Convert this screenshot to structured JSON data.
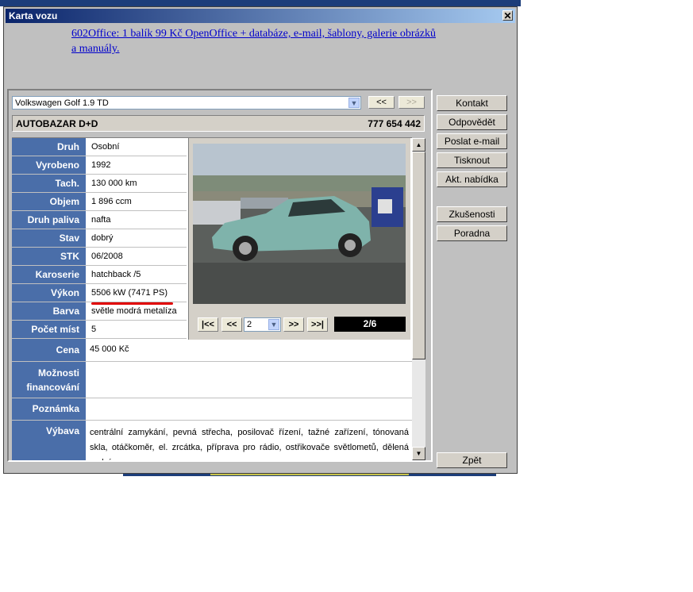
{
  "window": {
    "title": "Karta vozu"
  },
  "ad": {
    "text": "602Office: 1 balík 99 Kč OpenOffice + databáze, e-mail, šablony, galerie obrázků a manuály."
  },
  "vehicle_select": {
    "selected": "Volkswagen Golf 1.9 TD",
    "prev_label": "<<",
    "next_label": ">>"
  },
  "dealer": {
    "name": "AUTOBAZAR D+D",
    "phone": "777 654 442"
  },
  "details": [
    {
      "label": "Druh",
      "value": "Osobní"
    },
    {
      "label": "Vyrobeno",
      "value": "1992"
    },
    {
      "label": "Tach.",
      "value": "130 000  km"
    },
    {
      "label": "Objem",
      "value": "1 896  ccm"
    },
    {
      "label": "Druh paliva",
      "value": "nafta"
    },
    {
      "label": "Stav",
      "value": "dobrý"
    },
    {
      "label": "STK",
      "value": "06/2008"
    },
    {
      "label": "Karoserie",
      "value": "hatchback /5"
    },
    {
      "label": "Výkon",
      "value": "5506 kW (7471 PS)"
    },
    {
      "label": "Barva",
      "value": "světle modrá metalíza"
    },
    {
      "label": "Počet míst",
      "value": "5"
    }
  ],
  "wide_details": {
    "price": {
      "label": "Cena",
      "value": "45 000 Kč"
    },
    "financing": {
      "label": "Možnosti financování",
      "value": ""
    },
    "note": {
      "label": "Poznámka",
      "value": ""
    },
    "equipment": {
      "label": "Výbava",
      "value": "centrální zamykání, pevná střecha, posilovač řízení, tažné zařízení, tónovaná skla, otáčkoměr, el. zrcátka, příprava pro rádio, ostřikovače světlometů, dělená zadní"
    }
  },
  "photo_nav": {
    "first": "|<<",
    "prev": "<<",
    "page": "2",
    "next": ">>",
    "last": ">>|",
    "counter": "2/6"
  },
  "side_buttons": {
    "kontakt": "Kontakt",
    "odpovedet": "Odpovědět",
    "poslat_email": "Poslat e-mail",
    "tisknout": "Tisknout",
    "akt_nabidka": "Akt. nabídka",
    "zkusenosti": "Zkušenosti",
    "poradna": "Poradna",
    "zpet": "Zpět"
  },
  "colors": {
    "label_bg": "#4a6ea9",
    "title_start": "#0a246a",
    "title_end": "#a6caf0",
    "underline": "#e00000"
  }
}
